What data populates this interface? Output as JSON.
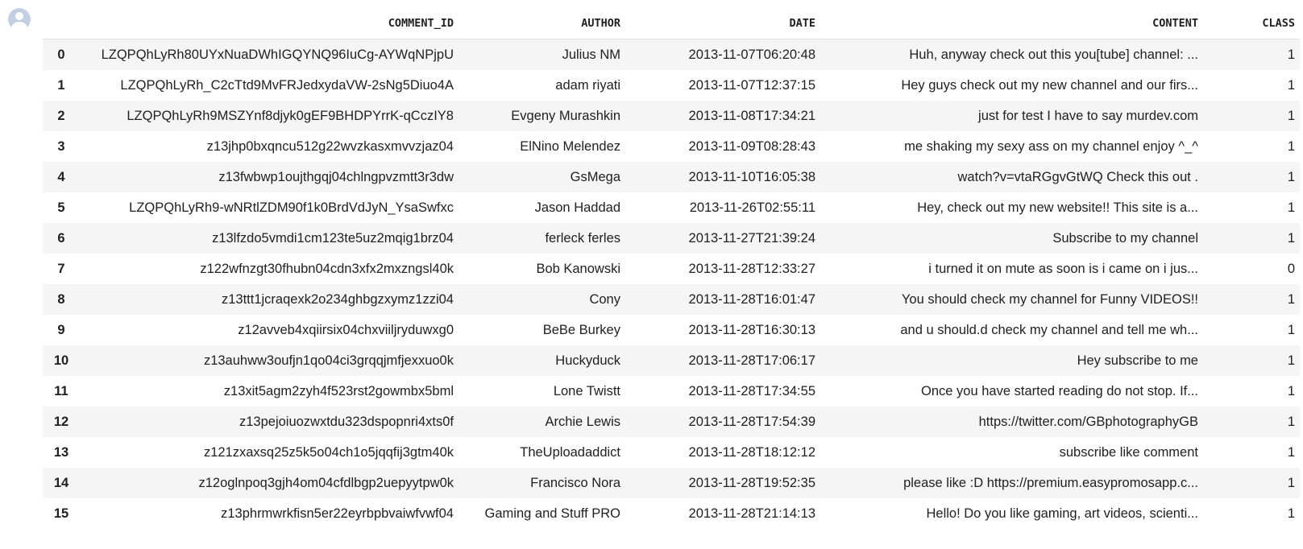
{
  "columns": [
    "COMMENT_ID",
    "AUTHOR",
    "DATE",
    "CONTENT",
    "CLASS"
  ],
  "rows": [
    {
      "idx": "0",
      "comment_id": "LZQPQhLyRh80UYxNuaDWhIGQYNQ96IuCg-AYWqNPjpU",
      "author": "Julius NM",
      "date": "2013-11-07T06:20:48",
      "content": "Huh, anyway check out this you[tube] channel: ...",
      "class": "1"
    },
    {
      "idx": "1",
      "comment_id": "LZQPQhLyRh_C2cTtd9MvFRJedxydaVW-2sNg5Diuo4A",
      "author": "adam riyati",
      "date": "2013-11-07T12:37:15",
      "content": "Hey guys check out my new channel and our firs...",
      "class": "1"
    },
    {
      "idx": "2",
      "comment_id": "LZQPQhLyRh9MSZYnf8djyk0gEF9BHDPYrrK-qCczIY8",
      "author": "Evgeny Murashkin",
      "date": "2013-11-08T17:34:21",
      "content": "just for test I have to say murdev.com",
      "class": "1"
    },
    {
      "idx": "3",
      "comment_id": "z13jhp0bxqncu512g22wvzkasxmvvzjaz04",
      "author": "ElNino Melendez",
      "date": "2013-11-09T08:28:43",
      "content": "me shaking my sexy ass on my channel enjoy ^_^",
      "class": "1"
    },
    {
      "idx": "4",
      "comment_id": "z13fwbwp1oujthgqj04chlngpvzmtt3r3dw",
      "author": "GsMega",
      "date": "2013-11-10T16:05:38",
      "content": "watch?v=vtaRGgvGtWQ   Check this out .",
      "class": "1"
    },
    {
      "idx": "5",
      "comment_id": "LZQPQhLyRh9-wNRtlZDM90f1k0BrdVdJyN_YsaSwfxc",
      "author": "Jason Haddad",
      "date": "2013-11-26T02:55:11",
      "content": "Hey, check out my new website!! This site is a...",
      "class": "1"
    },
    {
      "idx": "6",
      "comment_id": "z13lfzdo5vmdi1cm123te5uz2mqig1brz04",
      "author": "ferleck ferles",
      "date": "2013-11-27T21:39:24",
      "content": "Subscribe to my channel",
      "class": "1"
    },
    {
      "idx": "7",
      "comment_id": "z122wfnzgt30fhubn04cdn3xfx2mxzngsl40k",
      "author": "Bob Kanowski",
      "date": "2013-11-28T12:33:27",
      "content": "i turned it on mute as soon is i came on i jus...",
      "class": "0"
    },
    {
      "idx": "8",
      "comment_id": "z13ttt1jcraqexk2o234ghbgzxymz1zzi04",
      "author": "Cony",
      "date": "2013-11-28T16:01:47",
      "content": "You should check my channel for Funny VIDEOS!!",
      "class": "1"
    },
    {
      "idx": "9",
      "comment_id": "z12avveb4xqiirsix04chxviiljryduwxg0",
      "author": "BeBe Burkey",
      "date": "2013-11-28T16:30:13",
      "content": "and u should.d check my channel and tell me wh...",
      "class": "1"
    },
    {
      "idx": "10",
      "comment_id": "z13auhww3oufjn1qo04ci3grqqjmfjexxuo0k",
      "author": "Huckyduck",
      "date": "2013-11-28T17:06:17",
      "content": "Hey subscribe to me",
      "class": "1"
    },
    {
      "idx": "11",
      "comment_id": "z13xit5agm2zyh4f523rst2gowmbx5bml",
      "author": "Lone Twistt",
      "date": "2013-11-28T17:34:55",
      "content": "Once you have started reading do not stop. If...",
      "class": "1"
    },
    {
      "idx": "12",
      "comment_id": "z13pejoiuozwxtdu323dspopnri4xts0f",
      "author": "Archie Lewis",
      "date": "2013-11-28T17:54:39",
      "content": "https://twitter.com/GBphotographyGB",
      "class": "1"
    },
    {
      "idx": "13",
      "comment_id": "z121zxaxsq25z5k5o04ch1o5jqqfij3gtm40k",
      "author": "TheUploadaddict",
      "date": "2013-11-28T18:12:12",
      "content": "subscribe like comment",
      "class": "1"
    },
    {
      "idx": "14",
      "comment_id": "z12oglnpoq3gjh4om04cfdlbgp2uepyytpw0k",
      "author": "Francisco Nora",
      "date": "2013-11-28T19:52:35",
      "content": "please like :D https://premium.easypromosapp.c...",
      "class": "1"
    },
    {
      "idx": "15",
      "comment_id": "z13phrmwrkfisn5er22eyrbpbvaiwfvwf04",
      "author": "Gaming and Stuff PRO",
      "date": "2013-11-28T21:14:13",
      "content": "Hello! Do you like gaming, art videos, scienti...",
      "class": "1"
    }
  ]
}
